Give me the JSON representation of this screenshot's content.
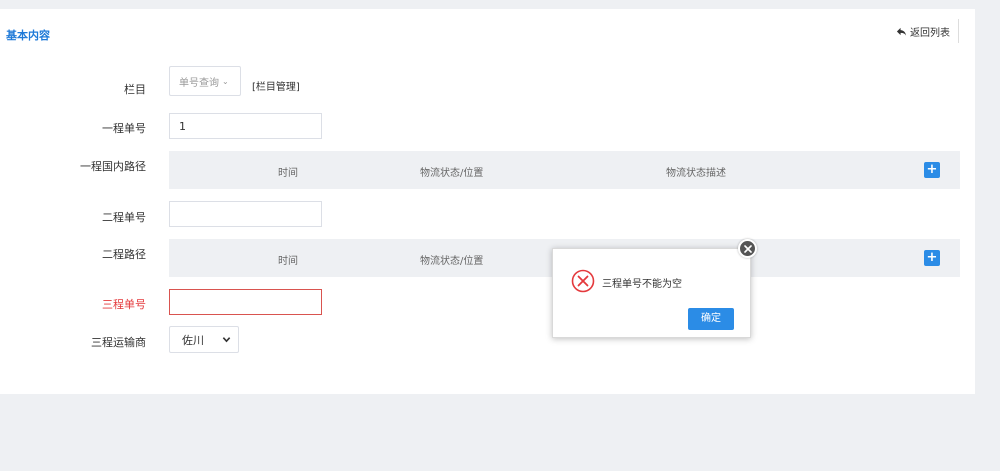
{
  "header": {
    "section_title": "基本内容",
    "back_label": "返回列表",
    "back_icon": "reply-arrow-icon"
  },
  "form": {
    "column": {
      "label": "栏目",
      "select_value": "单号查询",
      "manage_link": "[栏目管理]"
    },
    "first_leg_number": {
      "label": "一程单号",
      "value": "1"
    },
    "first_leg_domestic_route": {
      "label": "一程国内路径",
      "columns": [
        "时间",
        "物流状态/位置",
        "物流状态描述"
      ]
    },
    "second_leg_number": {
      "label": "二程单号",
      "value": ""
    },
    "second_leg_route": {
      "label": "二程路径",
      "columns": [
        "时间",
        "物流状态/位置"
      ]
    },
    "third_leg_number": {
      "label": "三程单号",
      "value": ""
    },
    "third_leg_carrier": {
      "label": "三程运输商",
      "value": "佐川"
    }
  },
  "dialog": {
    "message": "三程单号不能为空",
    "confirm_label": "确定"
  },
  "colors": {
    "accent": "#2b8ce6",
    "error": "#e4393c",
    "title": "#1f7ad8"
  }
}
